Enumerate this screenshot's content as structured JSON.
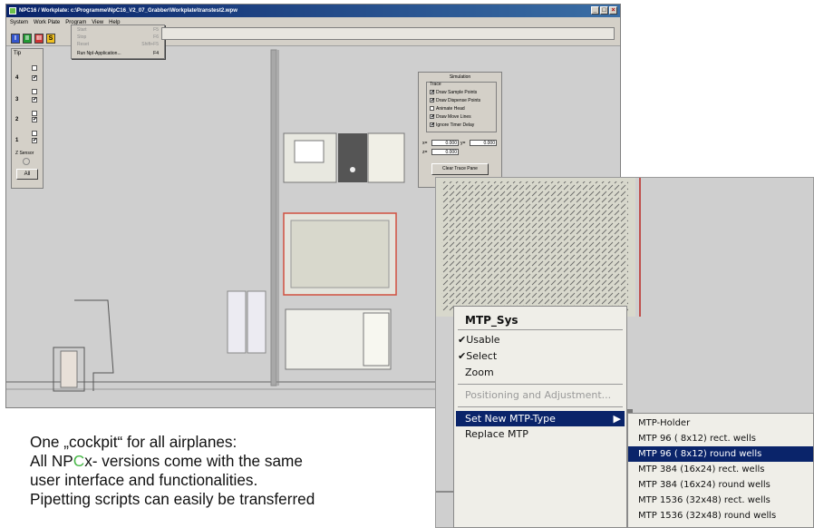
{
  "window": {
    "title": "NPC16 / Workplate: c:\\Programme\\NpC16_V2_07_Grabber\\Workplate\\transtest2.wpw",
    "buttons": [
      "_",
      "□",
      "×"
    ]
  },
  "menubar": [
    "System",
    "Work Plate",
    "Program",
    "View",
    "Help"
  ],
  "toolbar": {
    "icons": [
      "I",
      "II",
      "III",
      "S"
    ]
  },
  "program_menu": {
    "items": [
      {
        "label": "Start",
        "key": "F5",
        "disabled": true
      },
      {
        "label": "Stop",
        "key": "F6",
        "disabled": true
      },
      {
        "label": "Reset",
        "key": "Shift+F5",
        "disabled": true
      },
      {
        "label": "Run NpI-Application...",
        "key": "F4",
        "disabled": false
      }
    ]
  },
  "tip_panel": {
    "title": "Tip",
    "tips": [
      "4",
      "3",
      "2",
      "1"
    ],
    "z_sensor": "Z Sensor",
    "all_label": "All"
  },
  "simulation": {
    "title": "Simulation",
    "trace_label": "Trace",
    "options": [
      {
        "label": "Draw Sample Points",
        "checked": true
      },
      {
        "label": "Draw Dispense Points",
        "checked": true
      },
      {
        "label": "Animate Head",
        "checked": false
      },
      {
        "label": "Draw Move Lines",
        "checked": true
      },
      {
        "label": "Ignore Timer Delay",
        "checked": true
      }
    ],
    "x_label": "x=",
    "x_value": "0.000",
    "y_label": "y=",
    "y_value": "0.000",
    "z_label": "z=",
    "z_value": "0.000",
    "clear_button": "Clear Trace Pane"
  },
  "context_menu": {
    "title": "MTP_Sys",
    "items": [
      {
        "label": "Usable",
        "checked": true
      },
      {
        "label": "Select",
        "checked": true
      },
      {
        "label": "Zoom",
        "checked": false
      },
      {
        "label": "Positioning and Adjustment...",
        "disabled": true
      },
      {
        "label": "Set New MTP-Type",
        "selected": true,
        "submenu": true
      },
      {
        "label": "Replace MTP"
      }
    ]
  },
  "submenu": {
    "items": [
      "MTP-Holder",
      "MTP 96 ( 8x12) rect. wells",
      "MTP 96 ( 8x12) round wells",
      "MTP 384 (16x24) rect. wells",
      "MTP 384 (16x24) round wells",
      "MTP 1536 (32x48) rect. wells",
      "MTP 1536 (32x48) round wells"
    ],
    "selected_index": 2
  },
  "caption": {
    "line1": "One „cockpit“ for all airplanes:",
    "line2_pre": "All NP",
    "line2_hl": "C",
    "line2_post": "x- versions come with the same",
    "line3": "user interface and functionalities.",
    "line4": "Pipetting scripts can easily be transferred"
  },
  "colors": {
    "selection": "#0a246a",
    "accent_green": "#48b848",
    "plate_border": "#d05040"
  }
}
